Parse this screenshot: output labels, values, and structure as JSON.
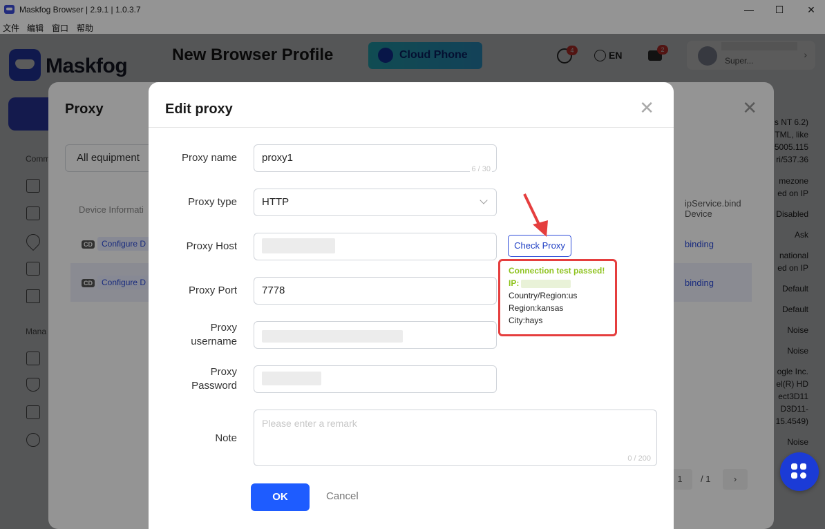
{
  "window": {
    "title": "Maskfog Browser | 2.9.1 | 1.0.3.7",
    "controls": [
      "—",
      "☐",
      "✕"
    ]
  },
  "menu": [
    "文件",
    "编辑",
    "窗口",
    "帮助"
  ],
  "app": {
    "logo": "Maskfog",
    "page_title": "New Browser Profile",
    "cloud_phone": "Cloud Phone",
    "lang": "EN",
    "sync_badge": "4",
    "msg_badge": "2",
    "user_name": "Super...",
    "sidebar_labels": [
      "Comm",
      "Mana"
    ],
    "right_fragments": [
      "s NT 6.2)",
      "TML, like",
      "5005.115",
      "ri/537.36",
      "mezone",
      "ed on IP",
      "Disabled",
      "Ask",
      "national",
      "ed on IP",
      "Default",
      "Default",
      "Noise",
      "Noise",
      "ogle Inc.",
      "el(R) HD",
      "ect3D11",
      "D3D11-",
      "15.4549)",
      "Noise"
    ]
  },
  "proxy_panel": {
    "title": "Proxy",
    "filter": "All equipment",
    "col_device": "Device Informati",
    "col_bind_1": "ipService.bind",
    "col_bind_2": "Device",
    "rows": [
      {
        "tag": "CD",
        "configure": "Configure D",
        "bind": "binding"
      },
      {
        "tag": "CD",
        "configure": "Configure D",
        "bind": "binding"
      }
    ],
    "page_current": "1",
    "page_total": "/ 1"
  },
  "modal": {
    "title": "Edit proxy",
    "fields": {
      "name_label": "Proxy name",
      "name_value": "proxy1",
      "name_count": "6 / 30",
      "type_label": "Proxy type",
      "type_value": "HTTP",
      "host_label": "Proxy Host",
      "port_label": "Proxy Port",
      "port_value": "7778",
      "user_label_1": "Proxy",
      "user_label_2": "username",
      "pass_label_1": "Proxy",
      "pass_label_2": "Password",
      "note_label": "Note",
      "note_placeholder": "Please enter a remark",
      "note_count": "0 / 200"
    },
    "check_proxy": "Check Proxy",
    "result": {
      "status": "Connection test passed!",
      "ip": "IP:",
      "country": "Country/Region:us",
      "region": "Region:kansas",
      "city": "City:hays"
    },
    "ok": "OK",
    "cancel": "Cancel"
  },
  "colors": {
    "accent": "#1e5cff",
    "pass_green": "#8fc31f",
    "highlight_red": "#e53e3e"
  }
}
